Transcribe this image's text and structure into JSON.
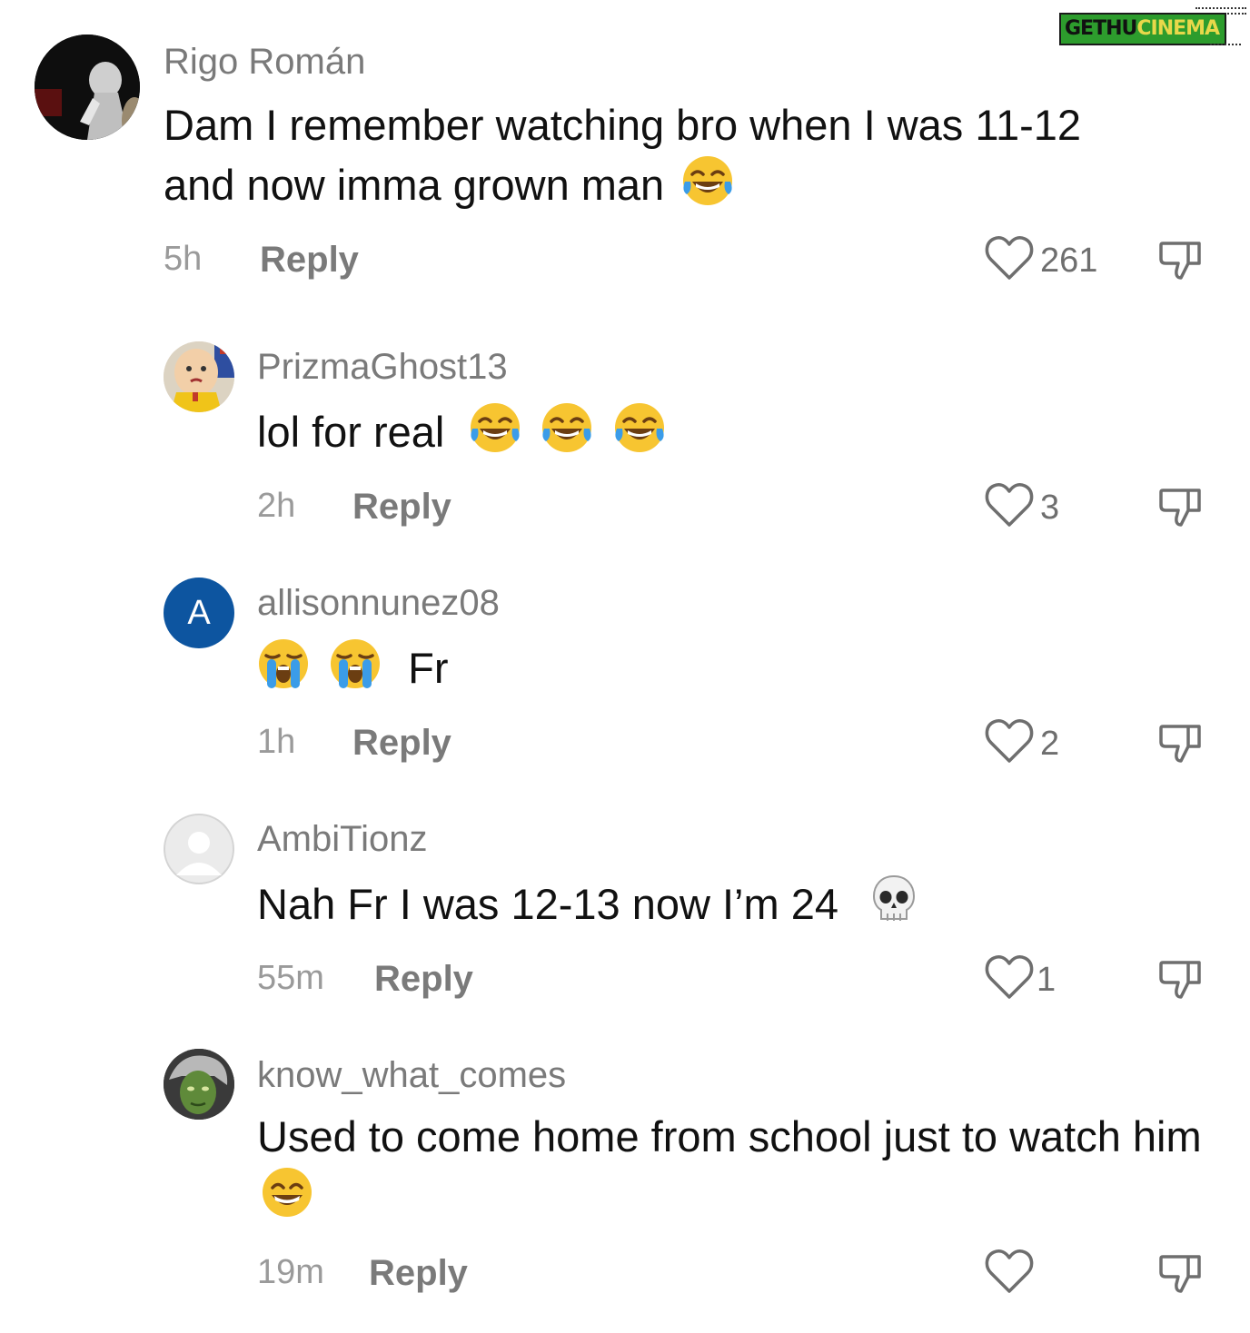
{
  "watermark": {
    "part1": "GETHU",
    "part2": "CINEMA"
  },
  "comments": [
    {
      "username": "Rigo Román",
      "text": "Dam I remember watching bro when I was 11-12 and now imma grown man",
      "emojis": [
        "face-with-tears-of-joy"
      ],
      "time": "5h",
      "reply_label": "Reply",
      "likes": "261"
    },
    {
      "username": "PrizmaGhost13",
      "text": "lol for real",
      "emojis": [
        "face-with-tears-of-joy",
        "face-with-tears-of-joy",
        "face-with-tears-of-joy"
      ],
      "time": "2h",
      "reply_label": "Reply",
      "likes": "3"
    },
    {
      "username": "allisonnunez08",
      "avatar_letter": "A",
      "text": "Fr",
      "emojis": [
        "loudly-crying-face",
        "loudly-crying-face"
      ],
      "time": "1h",
      "reply_label": "Reply",
      "likes": "2"
    },
    {
      "username": "AmbiTionz",
      "text": "Nah Fr I was 12-13 now I’m 24",
      "emojis": [
        "skull"
      ],
      "time": "55m",
      "reply_label": "Reply",
      "likes": "1"
    },
    {
      "username": "know_what_comes",
      "text": "Used to come home from school just to watch him",
      "emojis": [
        "grinning-face-with-smiling-eyes"
      ],
      "time": "19m",
      "reply_label": "Reply",
      "likes": ""
    }
  ],
  "colors": {
    "username": "#7a7a7a",
    "meta": "#9a9a9a",
    "avatar_letter_bg": "#0d55a0"
  },
  "icons": [
    "heart-outline-icon",
    "thumbs-down-icon"
  ]
}
